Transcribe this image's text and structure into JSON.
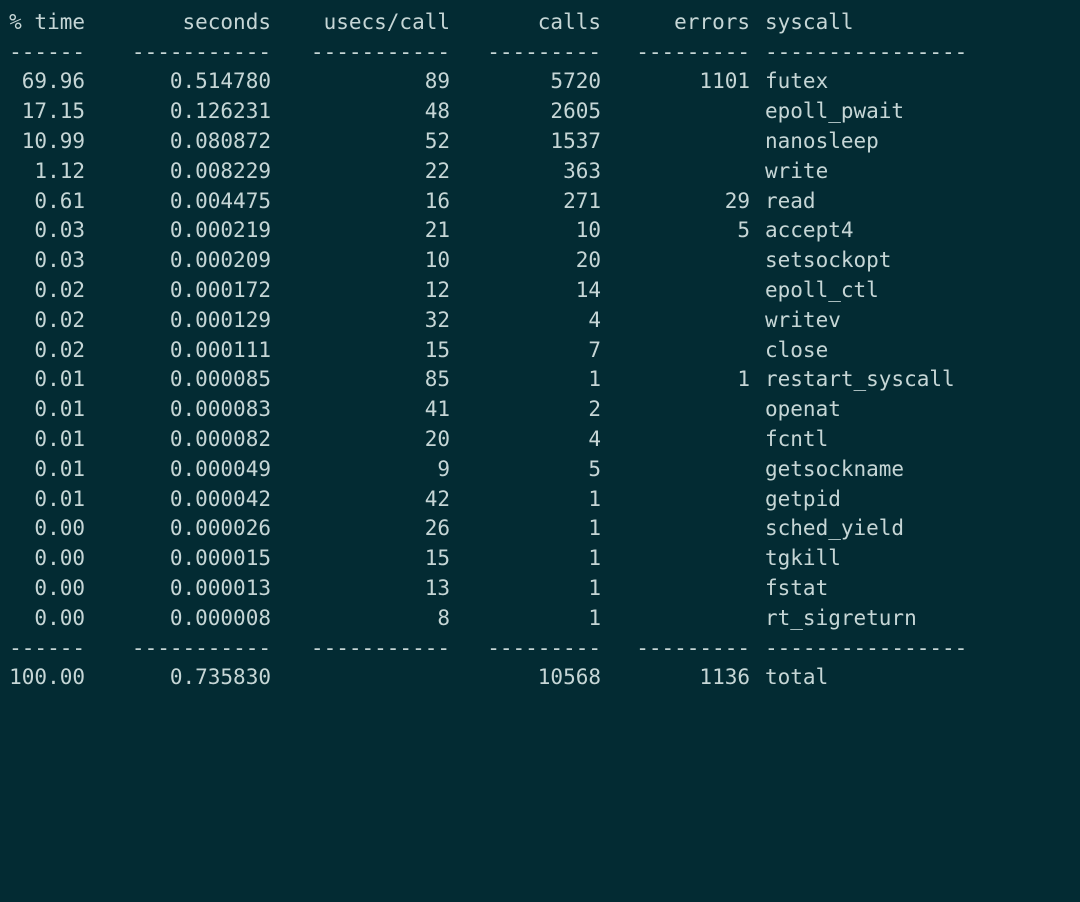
{
  "terminal": {
    "background_color": "#032b33",
    "foreground_color": "#c6d6d6",
    "program": "strace",
    "separator_segment": "------",
    "separator_segments": {
      "pct": "------",
      "seconds": "-----------",
      "usecs": "-----------",
      "calls": "---------",
      "errors": "---------",
      "syscall": "----------------"
    }
  },
  "table": {
    "columns": [
      {
        "key": "pct",
        "header": "% time",
        "align": "right"
      },
      {
        "key": "seconds",
        "header": "seconds",
        "align": "right"
      },
      {
        "key": "usecs",
        "header": "usecs/call",
        "align": "right"
      },
      {
        "key": "calls",
        "header": "calls",
        "align": "right"
      },
      {
        "key": "errors",
        "header": "errors",
        "align": "right"
      },
      {
        "key": "syscall",
        "header": "syscall",
        "align": "left"
      }
    ],
    "rows": [
      {
        "pct": "69.96",
        "seconds": "0.514780",
        "usecs": "89",
        "calls": "5720",
        "errors": "1101",
        "syscall": "futex"
      },
      {
        "pct": "17.15",
        "seconds": "0.126231",
        "usecs": "48",
        "calls": "2605",
        "errors": "",
        "syscall": "epoll_pwait"
      },
      {
        "pct": "10.99",
        "seconds": "0.080872",
        "usecs": "52",
        "calls": "1537",
        "errors": "",
        "syscall": "nanosleep"
      },
      {
        "pct": "1.12",
        "seconds": "0.008229",
        "usecs": "22",
        "calls": "363",
        "errors": "",
        "syscall": "write"
      },
      {
        "pct": "0.61",
        "seconds": "0.004475",
        "usecs": "16",
        "calls": "271",
        "errors": "29",
        "syscall": "read"
      },
      {
        "pct": "0.03",
        "seconds": "0.000219",
        "usecs": "21",
        "calls": "10",
        "errors": "5",
        "syscall": "accept4"
      },
      {
        "pct": "0.03",
        "seconds": "0.000209",
        "usecs": "10",
        "calls": "20",
        "errors": "",
        "syscall": "setsockopt"
      },
      {
        "pct": "0.02",
        "seconds": "0.000172",
        "usecs": "12",
        "calls": "14",
        "errors": "",
        "syscall": "epoll_ctl"
      },
      {
        "pct": "0.02",
        "seconds": "0.000129",
        "usecs": "32",
        "calls": "4",
        "errors": "",
        "syscall": "writev"
      },
      {
        "pct": "0.02",
        "seconds": "0.000111",
        "usecs": "15",
        "calls": "7",
        "errors": "",
        "syscall": "close"
      },
      {
        "pct": "0.01",
        "seconds": "0.000085",
        "usecs": "85",
        "calls": "1",
        "errors": "1",
        "syscall": "restart_syscall"
      },
      {
        "pct": "0.01",
        "seconds": "0.000083",
        "usecs": "41",
        "calls": "2",
        "errors": "",
        "syscall": "openat"
      },
      {
        "pct": "0.01",
        "seconds": "0.000082",
        "usecs": "20",
        "calls": "4",
        "errors": "",
        "syscall": "fcntl"
      },
      {
        "pct": "0.01",
        "seconds": "0.000049",
        "usecs": "9",
        "calls": "5",
        "errors": "",
        "syscall": "getsockname"
      },
      {
        "pct": "0.01",
        "seconds": "0.000042",
        "usecs": "42",
        "calls": "1",
        "errors": "",
        "syscall": "getpid"
      },
      {
        "pct": "0.00",
        "seconds": "0.000026",
        "usecs": "26",
        "calls": "1",
        "errors": "",
        "syscall": "sched_yield"
      },
      {
        "pct": "0.00",
        "seconds": "0.000015",
        "usecs": "15",
        "calls": "1",
        "errors": "",
        "syscall": "tgkill"
      },
      {
        "pct": "0.00",
        "seconds": "0.000013",
        "usecs": "13",
        "calls": "1",
        "errors": "",
        "syscall": "fstat"
      },
      {
        "pct": "0.00",
        "seconds": "0.000008",
        "usecs": "8",
        "calls": "1",
        "errors": "",
        "syscall": "rt_sigreturn"
      }
    ],
    "total": {
      "pct": "100.00",
      "seconds": "0.735830",
      "usecs": "",
      "calls": "10568",
      "errors": "1136",
      "syscall": "total"
    }
  }
}
